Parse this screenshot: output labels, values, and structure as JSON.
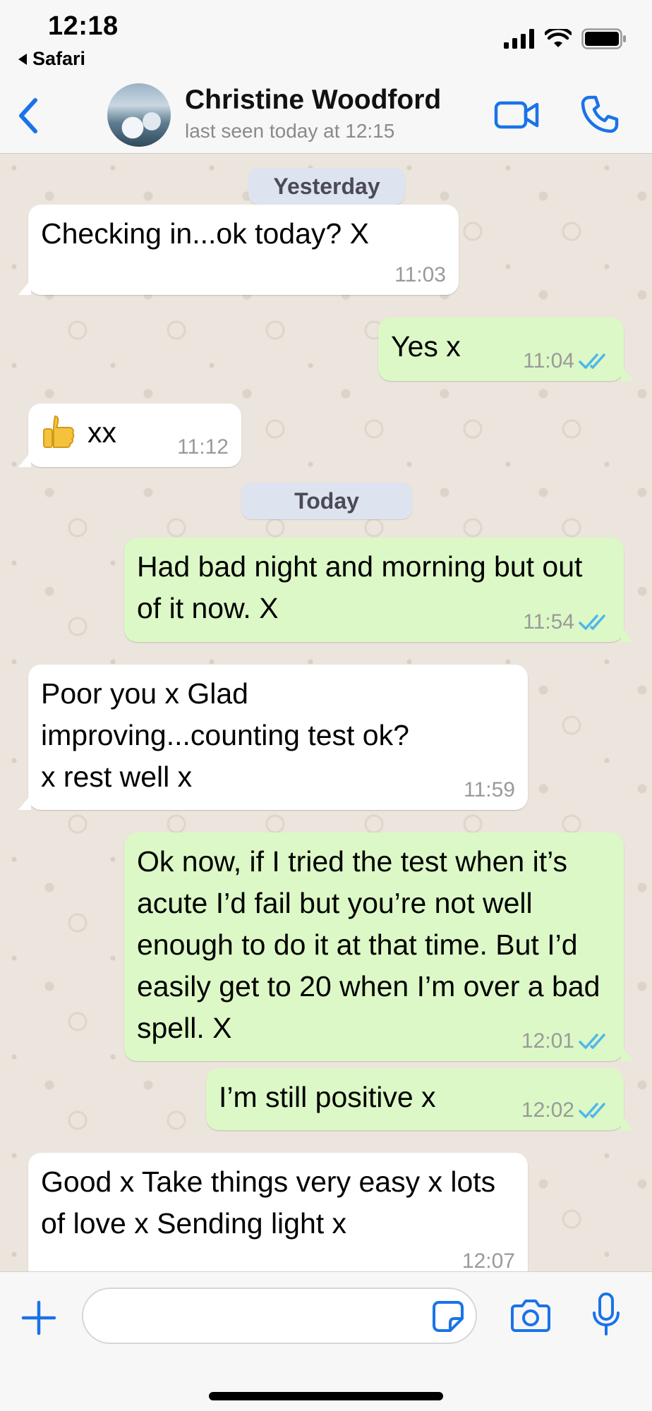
{
  "status_bar": {
    "time": "12:18",
    "back_app_label": "Safari",
    "icons": [
      "signal-icon",
      "wifi-icon",
      "battery-icon"
    ]
  },
  "header": {
    "contact_name": "Christine Woodford",
    "last_seen": "last seen today at 12:15",
    "icons": [
      "back-chevron-icon",
      "video-call-icon",
      "phone-icon"
    ]
  },
  "chat": {
    "date_yesterday": "Yesterday",
    "date_today": "Today",
    "messages": [
      {
        "direction": "incoming",
        "text": "Checking in...ok today? X",
        "time": "11:03"
      },
      {
        "direction": "outgoing",
        "text": "Yes x",
        "time": "11:04",
        "read": true
      },
      {
        "direction": "incoming",
        "emoji": "thumbs-up-icon",
        "text": "xx",
        "time": "11:12"
      },
      {
        "direction": "outgoing",
        "text": "Had bad night and morning but out of it now. X",
        "time": "11:54",
        "read": true
      },
      {
        "direction": "incoming",
        "text": "Poor you x Glad improving...counting test ok? x rest well x",
        "time": "11:59"
      },
      {
        "direction": "outgoing",
        "text": "Ok now, if I tried the test when it’s acute I’d fail but you’re not well enough to do it at that time. But I’d easily get to 20 when I’m over a bad spell. X",
        "time": "12:01",
        "read": true
      },
      {
        "direction": "outgoing",
        "text": "I’m still positive x",
        "time": "12:02",
        "read": true
      },
      {
        "direction": "incoming",
        "text": "Good x Take things very easy x lots of love x Sending light x",
        "time": "12:07"
      }
    ]
  },
  "input_bar": {
    "message_value": "",
    "icons": [
      "plus-icon",
      "sticker-icon",
      "camera-icon",
      "microphone-icon"
    ]
  },
  "colors": {
    "accent": "#1a73e8",
    "incoming_bubble": "#ffffff",
    "outgoing_bubble": "#dcf8c6",
    "read_ticks": "#4fb6ec",
    "chat_background": "#ece5dd",
    "date_chip": "#dde3ef"
  }
}
